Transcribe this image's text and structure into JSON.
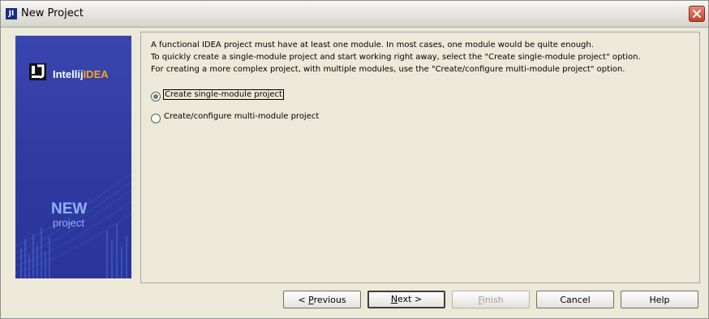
{
  "window": {
    "title": "New Project",
    "app_icon_glyph": "JI",
    "close_label": "close-icon"
  },
  "banner": {
    "logo_text_prefix": "Intellij",
    "logo_text_suffix": "IDEA",
    "new_label": "NEW",
    "project_label": "project",
    "colors": {
      "background": "#2f3aa0",
      "accent_orange": "#f7a51b",
      "accent_blue": "#8fb3ff"
    }
  },
  "description": {
    "line1": "A functional IDEA project must have at least one module. In most cases, one module would be quite enough.",
    "line2": "To quickly create a single-module project and start working right away, select the \"Create single-module project\" option.",
    "line3": "For creating a more complex project, with multiple modules, use the \"Create/configure multi-module project\" option."
  },
  "options": [
    {
      "label": "Create single-module project",
      "selected": true
    },
    {
      "label": "Create/configure multi-module project",
      "selected": false
    }
  ],
  "buttons": {
    "previous": {
      "pre": "< ",
      "mnemonic": "P",
      "post": "revious"
    },
    "next": {
      "mnemonic": "N",
      "post": "ext >"
    },
    "finish": {
      "mnemonic": "F",
      "post": "inish",
      "enabled": false
    },
    "cancel": {
      "label": "Cancel"
    },
    "help": {
      "label": "Help"
    }
  }
}
